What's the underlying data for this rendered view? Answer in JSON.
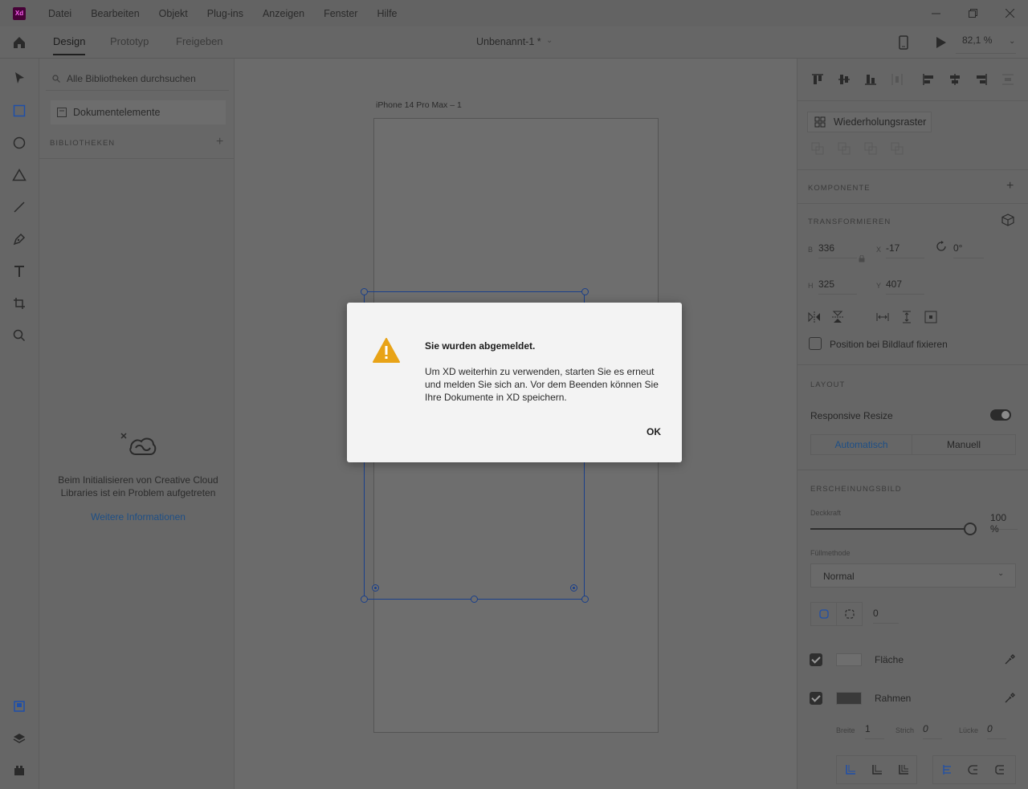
{
  "menubar": {
    "app_logo": "Xd",
    "items": [
      "Datei",
      "Bearbeiten",
      "Objekt",
      "Plug-ins",
      "Anzeigen",
      "Fenster",
      "Hilfe"
    ]
  },
  "toolbar": {
    "tabs": [
      "Design",
      "Prototyp",
      "Freigeben"
    ],
    "active_tab": "Design",
    "document_title": "Unbenannt-1 *",
    "zoom": "82,1 %"
  },
  "library": {
    "search_placeholder": "Alle Bibliotheken durchsuchen",
    "document_elements": "Dokumentelemente",
    "libraries_heading": "BIBLIOTHEKEN",
    "error_message": "Beim Initialisieren von Creative Cloud Libraries ist ein Problem aufgetreten",
    "more_info_link": "Weitere Informationen"
  },
  "canvas": {
    "artboard_label": "iPhone 14 Pro Max – 1"
  },
  "properties": {
    "repeat_grid": "Wiederholungsraster",
    "component_heading": "KOMPONENTE",
    "transform_heading": "TRANSFORMIEREN",
    "w_label": "B",
    "w_value": "336",
    "x_label": "X",
    "x_value": "-17",
    "rotation_value": "0°",
    "h_label": "H",
    "h_value": "325",
    "y_label": "Y",
    "y_value": "407",
    "fix_position": "Position bei Bildlauf fixieren",
    "layout_heading": "LAYOUT",
    "responsive_resize": "Responsive Resize",
    "responsive_resize_on": true,
    "mode_auto": "Automatisch",
    "mode_manual": "Manuell",
    "appearance_heading": "ERSCHEINUNGSBILD",
    "opacity_label": "Deckkraft",
    "opacity_value": "100 %",
    "blend_label": "Füllmethode",
    "blend_value": "Normal",
    "corner_radius": "0",
    "fill_label": "Fläche",
    "fill_enabled": true,
    "fill_color": "#6e6e6e",
    "border_label": "Rahmen",
    "border_enabled": true,
    "border_color": "#3a3a3a",
    "width_label": "Breite",
    "width_value": "1",
    "dash_label": "Strich",
    "dash_value": "0",
    "gap_label": "Lücke",
    "gap_value": "0"
  },
  "dialog": {
    "title": "Sie wurden abgemeldet.",
    "message": "Um XD weiterhin zu verwenden, starten Sie es erneut und melden Sie sich an. Vor dem Beenden können Sie Ihre Dokumente in XD speichern.",
    "ok_label": "OK"
  },
  "colors": {
    "accent": "#1a3f8a",
    "link": "#1e4f86",
    "warning": "#e8a317"
  }
}
